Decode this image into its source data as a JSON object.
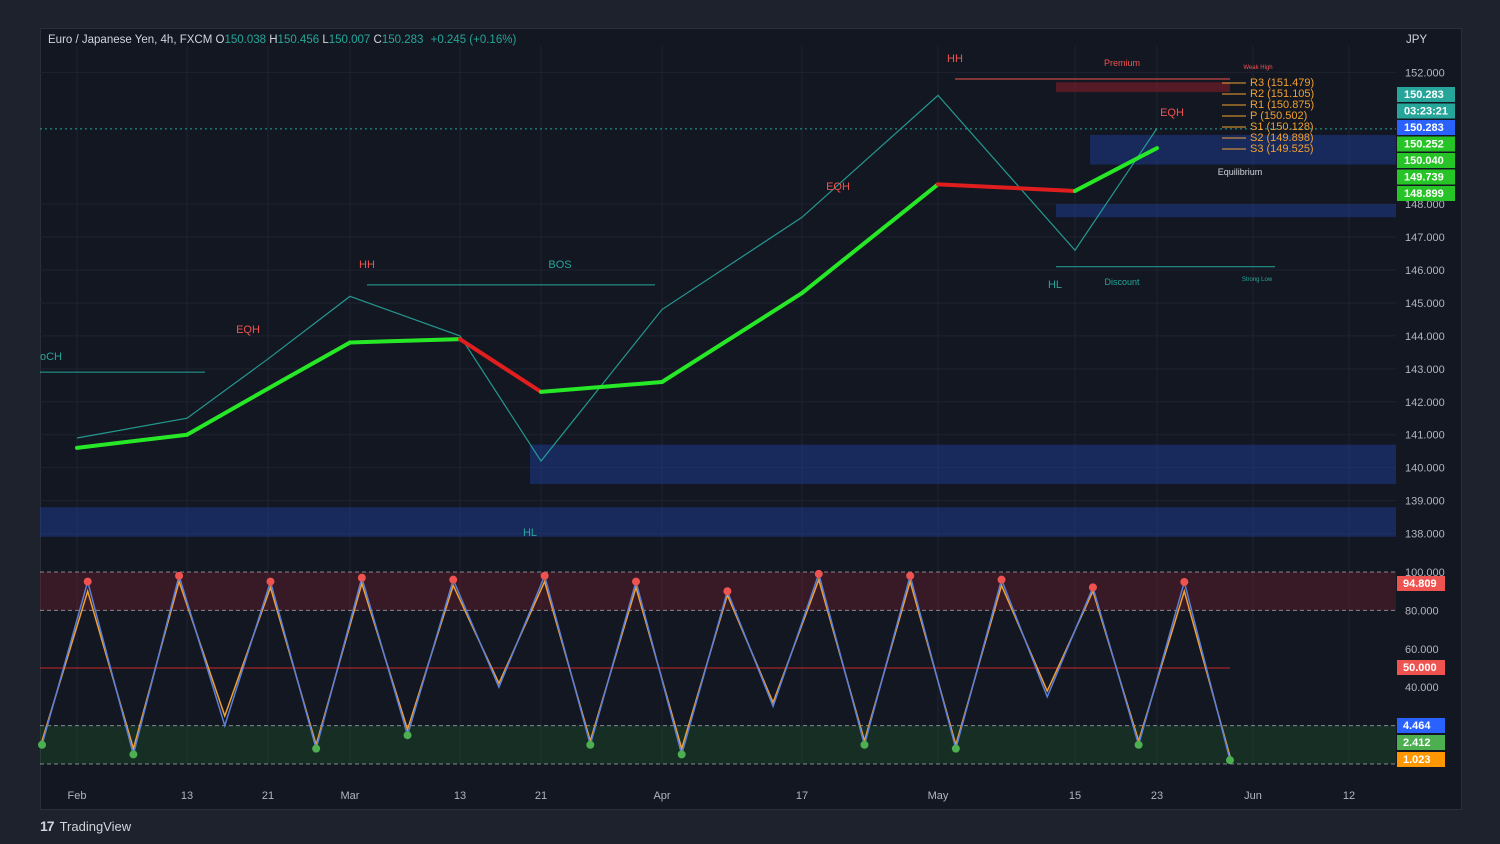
{
  "header": {
    "symbol": "Euro / Japanese Yen, 4h, FXCM",
    "open_label": "O",
    "open": "150.038",
    "high_label": "H",
    "high": "150.456",
    "low_label": "L",
    "low": "150.007",
    "close_label": "C",
    "close": "150.283",
    "change": "+0.245 (+0.16%)"
  },
  "currency": "JPY",
  "footer": {
    "brand": "TradingView"
  },
  "colors": {
    "bg": "#131722",
    "up": "#26a69a",
    "down": "#ef5350",
    "ma_bull": "#27e827",
    "ma_bear": "#e01e1e",
    "demand_zone": "#1e3a8a"
  },
  "chart_data": [
    {
      "type": "line",
      "title": "Euro / Japanese Yen, 4h, FXCM",
      "ylim": [
        137.5,
        152.8
      ],
      "y_ticks": [
        "152.000",
        "148.000",
        "147.000",
        "146.000",
        "145.000",
        "144.000",
        "143.000",
        "142.000",
        "141.000",
        "140.000",
        "139.000",
        "138.000"
      ],
      "x_ticks": [
        "Feb",
        "13",
        "21",
        "Mar",
        "13",
        "21",
        "Apr",
        "17",
        "May",
        "15",
        "23",
        "Jun",
        "12"
      ],
      "price_approx": {
        "x": [
          "Feb",
          "13",
          "21",
          "Mar",
          "13",
          "21",
          "Apr",
          "17",
          "May",
          "15",
          "23"
        ],
        "values": [
          140.9,
          141.5,
          143.3,
          145.2,
          144.0,
          140.2,
          144.8,
          147.6,
          151.3,
          146.6,
          150.3
        ]
      },
      "series": [
        {
          "name": "",
          "role": "slow-ma",
          "values": [
            140.6,
            141.0,
            142.4,
            143.8,
            143.9,
            142.3,
            142.6,
            145.3,
            148.6,
            148.4,
            149.7
          ]
        }
      ],
      "price_scale_labels": [
        {
          "value": "150.283",
          "color": "#26a69a"
        },
        {
          "value": "03:23:21",
          "color": "#26a69a"
        },
        {
          "value": "150.283",
          "color": "#2962ff"
        },
        {
          "value": "150.252",
          "color": "#27c427"
        },
        {
          "value": "150.040",
          "color": "#27c427"
        },
        {
          "value": "149.739",
          "color": "#27c427"
        },
        {
          "value": "148.899",
          "color": "#27c427"
        }
      ],
      "annotations": [
        "HH",
        "HH",
        "HH",
        "EQH",
        "EQH",
        "EQH",
        "BOS",
        "HL",
        "HL",
        "oCH",
        "Premium",
        "Discount",
        "Equilibrium",
        "Weak High",
        "Strong Low"
      ],
      "pivots": [
        "R3 (151.479)",
        "R2 (151.105)",
        "R1 (150.875)",
        "P (150.502)",
        "S1 (150.128)",
        "S2 (149.898)",
        "S3 (149.525)"
      ],
      "small_labels": [
        "BOS",
        "CHoCH"
      ]
    },
    {
      "type": "line",
      "title": "",
      "ylim": [
        0,
        100
      ],
      "y_ticks": [
        "100.000",
        "80.000",
        "60.000",
        "40.000"
      ],
      "series": [
        {
          "name": "",
          "role": "%K",
          "values": [
            10,
            95,
            5,
            98,
            20,
            95,
            8,
            97,
            15,
            96,
            40,
            98,
            10,
            95,
            5,
            90,
            30,
            99,
            10,
            98,
            8,
            96,
            35,
            92,
            10,
            94.8,
            2
          ]
        },
        {
          "name": "",
          "role": "%D",
          "values": [
            12,
            90,
            8,
            95,
            25,
            92,
            10,
            94,
            18,
            93,
            42,
            95,
            12,
            92,
            8,
            88,
            32,
            96,
            12,
            95,
            10,
            93,
            38,
            90,
            12,
            90,
            4
          ]
        }
      ],
      "levels": {
        "overbought": 80,
        "mid": 50,
        "oversold": 20
      },
      "price_scale_labels": [
        {
          "value": "94.809",
          "color": "#ef5350"
        },
        {
          "value": "50.000",
          "color": "#ef5350"
        },
        {
          "value": "4.464",
          "color": "#2962ff"
        },
        {
          "value": "2.412",
          "color": "#4caf50"
        },
        {
          "value": "1.023",
          "color": "#ff9800"
        }
      ]
    }
  ]
}
